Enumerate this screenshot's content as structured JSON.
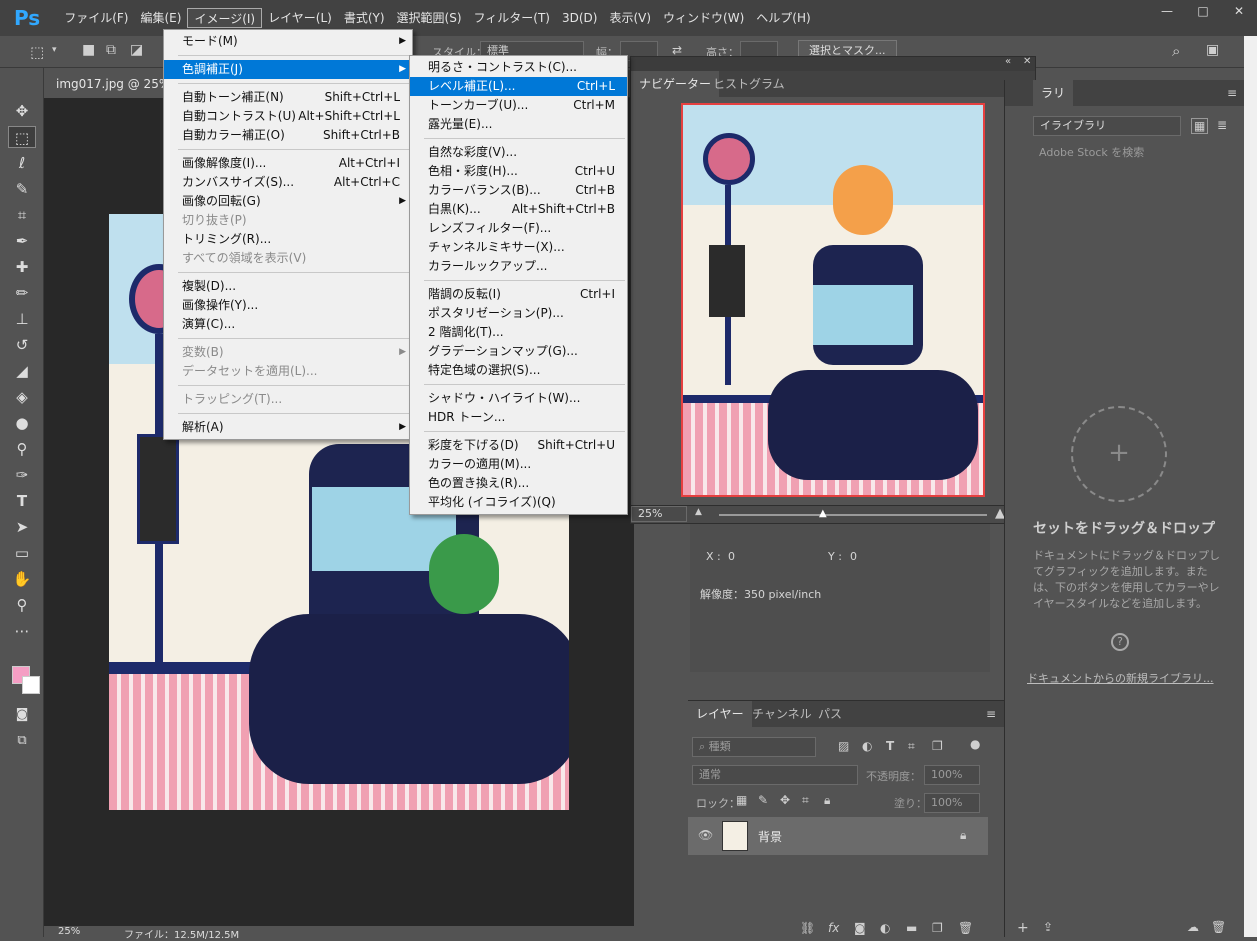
{
  "app": {
    "logo": "Ps",
    "menus": [
      "ファイル(F)",
      "編集(E)",
      "イメージ(I)",
      "レイヤー(L)",
      "書式(Y)",
      "選択範囲(S)",
      "フィルター(T)",
      "3D(D)",
      "表示(V)",
      "ウィンドウ(W)",
      "ヘルプ(H)"
    ],
    "active_menu": "イメージ(I)",
    "window_controls": [
      "—",
      "□",
      "✕"
    ]
  },
  "options_bar": {
    "style_label": "スタイル：",
    "style_value": "標準",
    "width_label": "幅：",
    "height_label": "高さ：",
    "select_mask_button": "選択とマスク..."
  },
  "document": {
    "tab_title": "img017.jpg @ 25%",
    "zoom": "25%",
    "file_info": "ファイル：12.5M/12.5M"
  },
  "image_menu": {
    "items": [
      {
        "label": "モード(M)",
        "shortcut": "",
        "submenu": true,
        "disabled": false
      },
      {
        "sep": true
      },
      {
        "label": "色調補正(J)",
        "shortcut": "",
        "submenu": true,
        "disabled": false,
        "highlighted": true
      },
      {
        "sep": true
      },
      {
        "label": "自動トーン補正(N)",
        "shortcut": "Shift+Ctrl+L",
        "disabled": false
      },
      {
        "label": "自動コントラスト(U)",
        "shortcut": "Alt+Shift+Ctrl+L",
        "disabled": false
      },
      {
        "label": "自動カラー補正(O)",
        "shortcut": "Shift+Ctrl+B",
        "disabled": false
      },
      {
        "sep": true
      },
      {
        "label": "画像解像度(I)...",
        "shortcut": "Alt+Ctrl+I",
        "disabled": false
      },
      {
        "label": "カンバスサイズ(S)...",
        "shortcut": "Alt+Ctrl+C",
        "disabled": false
      },
      {
        "label": "画像の回転(G)",
        "shortcut": "",
        "submenu": true,
        "disabled": false
      },
      {
        "label": "切り抜き(P)",
        "shortcut": "",
        "disabled": true
      },
      {
        "label": "トリミング(R)...",
        "shortcut": "",
        "disabled": false
      },
      {
        "label": "すべての領域を表示(V)",
        "shortcut": "",
        "disabled": true
      },
      {
        "sep": true
      },
      {
        "label": "複製(D)...",
        "shortcut": "",
        "disabled": false
      },
      {
        "label": "画像操作(Y)...",
        "shortcut": "",
        "disabled": false
      },
      {
        "label": "演算(C)...",
        "shortcut": "",
        "disabled": false
      },
      {
        "sep": true
      },
      {
        "label": "変数(B)",
        "shortcut": "",
        "submenu": true,
        "disabled": true
      },
      {
        "label": "データセットを適用(L)...",
        "shortcut": "",
        "disabled": true
      },
      {
        "sep": true
      },
      {
        "label": "トラッピング(T)...",
        "shortcut": "",
        "disabled": true
      },
      {
        "sep": true
      },
      {
        "label": "解析(A)",
        "shortcut": "",
        "submenu": true,
        "disabled": false
      }
    ]
  },
  "adjust_menu": {
    "items": [
      {
        "label": "明るさ・コントラスト(C)...",
        "shortcut": ""
      },
      {
        "label": "レベル補正(L)...",
        "shortcut": "Ctrl+L",
        "highlighted": true
      },
      {
        "label": "トーンカーブ(U)...",
        "shortcut": "Ctrl+M"
      },
      {
        "label": "露光量(E)...",
        "shortcut": ""
      },
      {
        "sep": true
      },
      {
        "label": "自然な彩度(V)...",
        "shortcut": ""
      },
      {
        "label": "色相・彩度(H)...",
        "shortcut": "Ctrl+U"
      },
      {
        "label": "カラーバランス(B)...",
        "shortcut": "Ctrl+B"
      },
      {
        "label": "白黒(K)...",
        "shortcut": "Alt+Shift+Ctrl+B"
      },
      {
        "label": "レンズフィルター(F)...",
        "shortcut": ""
      },
      {
        "label": "チャンネルミキサー(X)...",
        "shortcut": ""
      },
      {
        "label": "カラールックアップ...",
        "shortcut": ""
      },
      {
        "sep": true
      },
      {
        "label": "階調の反転(I)",
        "shortcut": "Ctrl+I"
      },
      {
        "label": "ポスタリゼーション(P)...",
        "shortcut": ""
      },
      {
        "label": "2 階調化(T)...",
        "shortcut": ""
      },
      {
        "label": "グラデーションマップ(G)...",
        "shortcut": ""
      },
      {
        "label": "特定色域の選択(S)...",
        "shortcut": ""
      },
      {
        "sep": true
      },
      {
        "label": "シャドウ・ハイライト(W)...",
        "shortcut": ""
      },
      {
        "label": "HDR トーン...",
        "shortcut": ""
      },
      {
        "sep": true
      },
      {
        "label": "彩度を下げる(D)",
        "shortcut": "Shift+Ctrl+U"
      },
      {
        "label": "カラーの適用(M)...",
        "shortcut": ""
      },
      {
        "label": "色の置き換え(R)...",
        "shortcut": ""
      },
      {
        "label": "平均化 (イコライズ)(Q)",
        "shortcut": ""
      }
    ]
  },
  "navigator": {
    "tabs": [
      "ナビゲーター",
      "ヒストグラム"
    ],
    "zoom": "25%"
  },
  "info_panel": {
    "x_label": "X :",
    "x_value": "0",
    "y_label": "Y :",
    "y_value": "0",
    "resolution": "解像度：350 pixel/inch"
  },
  "layers": {
    "tabs": [
      "レイヤー",
      "チャンネル",
      "パス"
    ],
    "filter_placeholder": "種類",
    "blend_mode": "通常",
    "opacity_label": "不透明度：",
    "opacity_value": "100%",
    "lock_label": "ロック：",
    "fill_label": "塗り：",
    "fill_value": "100%",
    "rows": [
      {
        "name": "背景",
        "visible": true,
        "locked": true
      }
    ]
  },
  "libraries": {
    "tab": "ラリ",
    "library_select": "イライブラリ",
    "search_placeholder": "Adobe Stock を検索",
    "drop_title": "セットをドラッグ＆ドロップ",
    "drop_help": "ドキュメントにドラッグ＆ドロップしてグラフィックを追加します。または、下のボタンを使用してカラーやレイヤースタイルなどを追加します。",
    "new_library_link": "ドキュメントからの新規ライブラリ..."
  },
  "colors": {
    "foreground": "#f59ec4",
    "background": "#ffffff",
    "menu_highlight": "#0078d7"
  }
}
